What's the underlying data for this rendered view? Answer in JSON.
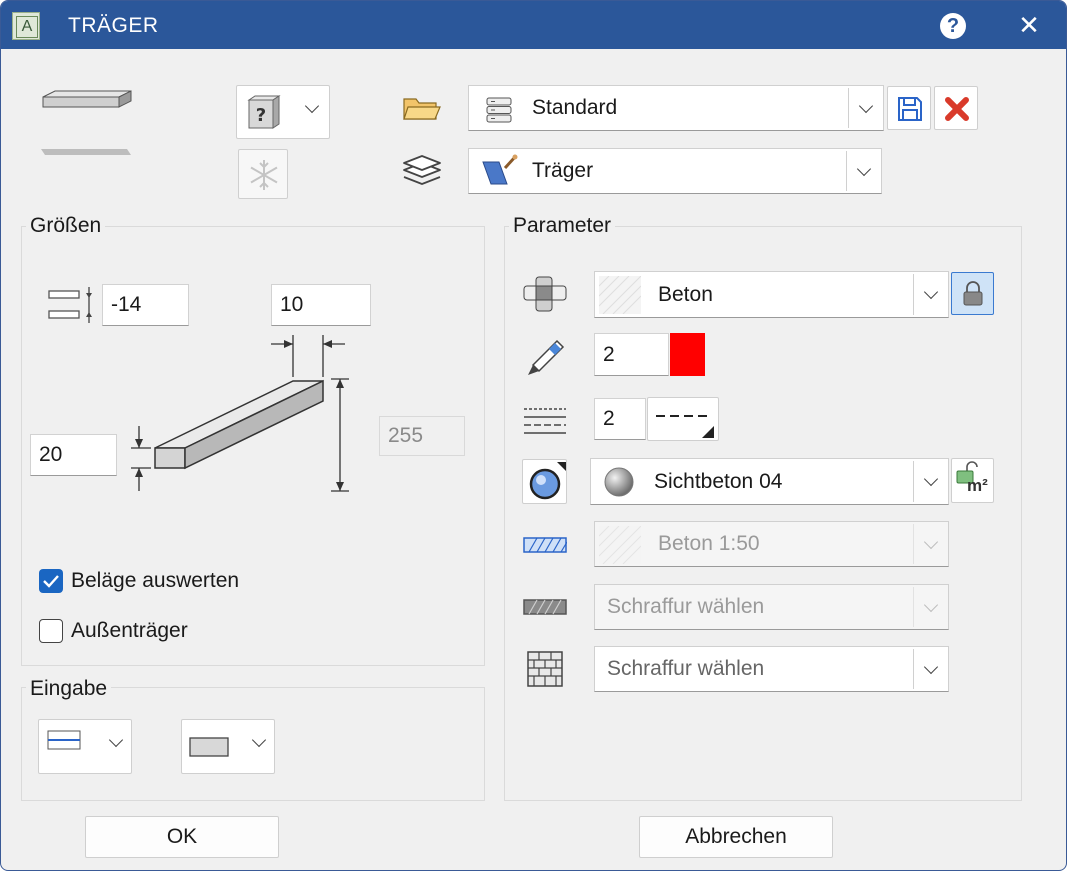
{
  "window": {
    "title": "TRÄGER",
    "help_glyph": "?",
    "close_glyph": "✕",
    "app_icon_letter": "A"
  },
  "top": {
    "style_combo_glyph": "?",
    "profile_combo": {
      "value": "Standard"
    },
    "layer_combo": {
      "value": "Träger"
    }
  },
  "groessen": {
    "label": "Größen",
    "offset_value": "-14",
    "width_value": "10",
    "height_value": "20",
    "length_value": "255",
    "belaege_label": "Beläge auswerten",
    "belaege_checked": true,
    "aussen_label": "Außenträger",
    "aussen_checked": false
  },
  "eingabe": {
    "label": "Eingabe"
  },
  "parameter": {
    "label": "Parameter",
    "material_value": "Beton",
    "pen_value": "2",
    "pen_color": "#ff0000",
    "linetype_value": "2",
    "surface_value": "Sichtbeton 04",
    "surface_badge": "m²",
    "hatch1_value": "Beton 1:50",
    "hatch2_value": "Schraffur wählen",
    "hatch3_value": "Schraffur wählen"
  },
  "buttons": {
    "ok": "OK",
    "cancel": "Abbrechen"
  },
  "colors": {
    "titlebar": "#2b579a",
    "accent": "#1a66c2",
    "delete": "#d93a2a"
  }
}
